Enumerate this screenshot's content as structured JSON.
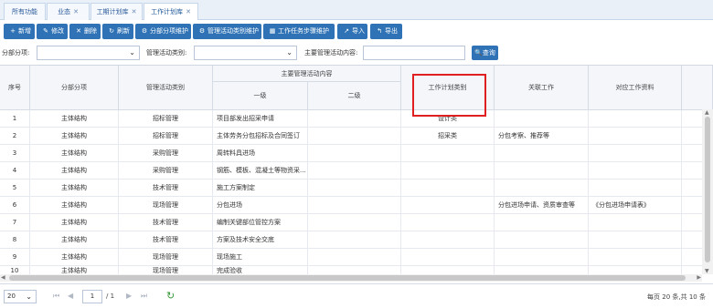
{
  "tabs": [
    {
      "label": "所有功能",
      "closable": false
    },
    {
      "label": "业态",
      "closable": true
    },
    {
      "label": "工期计划库",
      "closable": true
    },
    {
      "label": "工作计划库",
      "closable": true,
      "active": true
    }
  ],
  "toolbar": {
    "buttons": [
      {
        "label": "新增",
        "icon": "+"
      },
      {
        "label": "修改",
        "icon": "✎"
      },
      {
        "label": "删除",
        "icon": "✕"
      },
      {
        "label": "刷新",
        "icon": "↻"
      },
      {
        "label": "分部分项维护",
        "icon": "⚙"
      },
      {
        "label": "管理活动类别维护",
        "icon": "⚙"
      },
      {
        "label": "工作任务步骤维护",
        "icon": "▦"
      },
      {
        "label": "导入",
        "icon": "↗"
      },
      {
        "label": "导出",
        "icon": "↰"
      }
    ]
  },
  "filters": {
    "subitem_label": "分部分项:",
    "category_label": "管理活动类别:",
    "content_label": "主要管理活动内容:",
    "query_label": "查询",
    "query_icon": "search-icon"
  },
  "table": {
    "headers": {
      "index": "序号",
      "subitem": "分部分项",
      "category": "管理活动类别",
      "main_content": "主要管理活动内容",
      "level1": "一级",
      "level2": "二级",
      "plan_type": "工作计划类别",
      "related_work": "关联工作",
      "work_docs": "对应工作资料"
    },
    "rows": [
      {
        "index": "1",
        "subitem": "主体结构",
        "category": "招标管理",
        "level1": "项目部发出招采申请",
        "level2": "",
        "plan_type": "设计类",
        "related_work": "",
        "work_docs": ""
      },
      {
        "index": "2",
        "subitem": "主体结构",
        "category": "招标管理",
        "level1": "主体劳务分包招标及合同签订",
        "level2": "",
        "plan_type": "招采类",
        "related_work": "分包考察、推荐等",
        "work_docs": ""
      },
      {
        "index": "3",
        "subitem": "主体结构",
        "category": "采购管理",
        "level1": "周转料具进场",
        "level2": "",
        "plan_type": "",
        "related_work": "",
        "work_docs": ""
      },
      {
        "index": "4",
        "subitem": "主体结构",
        "category": "采购管理",
        "level1": "钢筋、模板、混凝土等物资采...",
        "level2": "",
        "plan_type": "",
        "related_work": "",
        "work_docs": ""
      },
      {
        "index": "5",
        "subitem": "主体结构",
        "category": "技术管理",
        "level1": "施工方案制定",
        "level2": "",
        "plan_type": "",
        "related_work": "",
        "work_docs": ""
      },
      {
        "index": "6",
        "subitem": "主体结构",
        "category": "现场管理",
        "level1": "分包进场",
        "level2": "",
        "plan_type": "",
        "related_work": "分包进场申请、资质审查等",
        "work_docs": "《分包进场申请表》"
      },
      {
        "index": "7",
        "subitem": "主体结构",
        "category": "技术管理",
        "level1": "编制关键部位管控方案",
        "level2": "",
        "plan_type": "",
        "related_work": "",
        "work_docs": ""
      },
      {
        "index": "8",
        "subitem": "主体结构",
        "category": "技术管理",
        "level1": "方案及技术安全交底",
        "level2": "",
        "plan_type": "",
        "related_work": "",
        "work_docs": ""
      },
      {
        "index": "9",
        "subitem": "主体结构",
        "category": "现场管理",
        "level1": "现场施工",
        "level2": "",
        "plan_type": "",
        "related_work": "",
        "work_docs": ""
      },
      {
        "index": "10",
        "subitem": "主体结构",
        "category": "现场管理",
        "level1": "完成验收",
        "level2": "",
        "plan_type": "",
        "related_work": "",
        "work_docs": ""
      }
    ]
  },
  "pager": {
    "page_size": "20",
    "current_page": "1",
    "total_pages": "/ 1",
    "summary": "每页 20 条,共 10 条"
  },
  "colors": {
    "primary": "#2f73b6",
    "highlight_border": "#e02020"
  }
}
